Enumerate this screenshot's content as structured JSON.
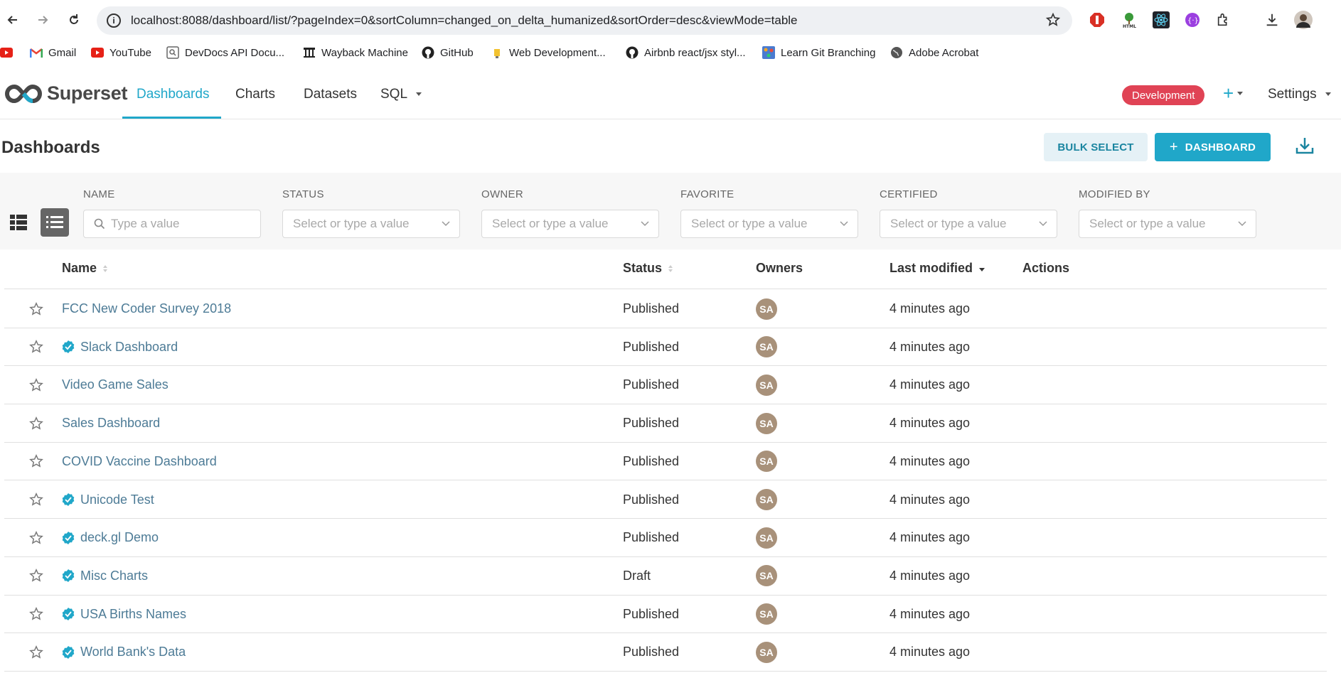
{
  "browser": {
    "url": "localhost:8088/dashboard/list/?pageIndex=0&sortColumn=changed_on_delta_humanized&sortOrder=desc&viewMode=table",
    "bookmarks": [
      {
        "label": "Gmail",
        "icon": "gmail-icon"
      },
      {
        "label": "YouTube",
        "icon": "youtube-icon"
      },
      {
        "label": "DevDocs API Docu...",
        "icon": "devdocs-icon"
      },
      {
        "label": "Wayback Machine",
        "icon": "wayback-icon"
      },
      {
        "label": "GitHub",
        "icon": "github-icon"
      },
      {
        "label": "Web Development...",
        "icon": "webdev-icon"
      },
      {
        "label": "Airbnb react/jsx styl...",
        "icon": "github-icon"
      },
      {
        "label": "Learn Git Branching",
        "icon": "git-branching-icon"
      },
      {
        "label": "Adobe Acrobat",
        "icon": "globe-icon"
      }
    ]
  },
  "header": {
    "brand": "Superset",
    "menu": [
      "Dashboards",
      "Charts",
      "Datasets",
      "SQL"
    ],
    "active_menu": "Dashboards",
    "environment": "Development",
    "settings_label": "Settings"
  },
  "subheader": {
    "title": "Dashboards",
    "bulk_select": "BULK SELECT",
    "add_dashboard": "DASHBOARD"
  },
  "filters": [
    {
      "label": "NAME",
      "placeholder": "Type a value",
      "type": "search"
    },
    {
      "label": "STATUS",
      "placeholder": "Select or type a value",
      "type": "select"
    },
    {
      "label": "OWNER",
      "placeholder": "Select or type a value",
      "type": "select"
    },
    {
      "label": "FAVORITE",
      "placeholder": "Select or type a value",
      "type": "select"
    },
    {
      "label": "CERTIFIED",
      "placeholder": "Select or type a value",
      "type": "select"
    },
    {
      "label": "MODIFIED BY",
      "placeholder": "Select or type a value",
      "type": "select"
    }
  ],
  "table": {
    "columns": [
      "Name",
      "Status",
      "Owners",
      "Last modified",
      "Actions"
    ],
    "rows": [
      {
        "name": "FCC New Coder Survey 2018",
        "certified": false,
        "status": "Published",
        "owner": "SA",
        "modified": "4 minutes ago"
      },
      {
        "name": "Slack Dashboard",
        "certified": true,
        "status": "Published",
        "owner": "SA",
        "modified": "4 minutes ago"
      },
      {
        "name": "Video Game Sales",
        "certified": false,
        "status": "Published",
        "owner": "SA",
        "modified": "4 minutes ago"
      },
      {
        "name": "Sales Dashboard",
        "certified": false,
        "status": "Published",
        "owner": "SA",
        "modified": "4 minutes ago"
      },
      {
        "name": "COVID Vaccine Dashboard",
        "certified": false,
        "status": "Published",
        "owner": "SA",
        "modified": "4 minutes ago"
      },
      {
        "name": "Unicode Test",
        "certified": true,
        "status": "Published",
        "owner": "SA",
        "modified": "4 minutes ago"
      },
      {
        "name": "deck.gl Demo",
        "certified": true,
        "status": "Published",
        "owner": "SA",
        "modified": "4 minutes ago"
      },
      {
        "name": "Misc Charts",
        "certified": true,
        "status": "Draft",
        "owner": "SA",
        "modified": "4 minutes ago"
      },
      {
        "name": "USA Births Names",
        "certified": true,
        "status": "Published",
        "owner": "SA",
        "modified": "4 minutes ago"
      },
      {
        "name": "World Bank's Data",
        "certified": true,
        "status": "Published",
        "owner": "SA",
        "modified": "4 minutes ago"
      }
    ]
  },
  "colors": {
    "brand_primary": "#20a7c9",
    "environment_badge": "#e04355",
    "avatar": "#a8917a",
    "link": "#4d7b96"
  }
}
